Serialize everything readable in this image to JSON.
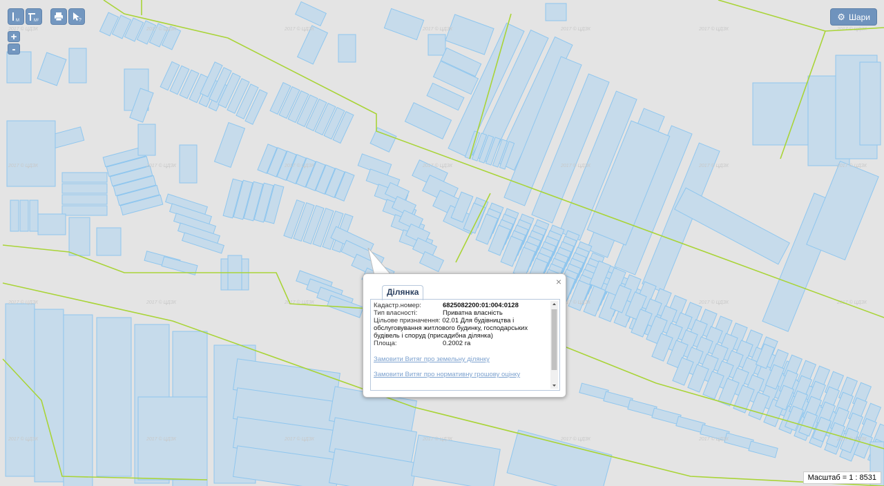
{
  "toolbar": {
    "buttons": [
      {
        "name": "ruler-m-button",
        "icon": "ruler-icon",
        "sub": "M"
      },
      {
        "name": "area-m2-button",
        "icon": "area-ruler-icon",
        "sub": "M²"
      },
      {
        "name": "print-button",
        "icon": "print-icon",
        "sub": ""
      },
      {
        "name": "info-pointer-button",
        "icon": "pointer-question-icon",
        "sub": "?"
      }
    ],
    "zoom_in": "+",
    "zoom_out": "-"
  },
  "layers_button": {
    "label": "Шари",
    "icon": "gear-icon"
  },
  "watermark": "2017 © ЦДЗК",
  "scale": {
    "text": "Масштаб = 1 : 8531"
  },
  "popup": {
    "tab": "Ділянка",
    "close": "×",
    "fields": [
      {
        "label": "Кадастр.номер:",
        "value": "6825082200:01:004:0128"
      },
      {
        "label": "Тип власності:",
        "value": "Приватна власність"
      },
      {
        "label": "Цільове призначення:",
        "value": "02.01 Для будівництва і обслуговування житлового будинку, господарських будівель і споруд (присадибна ділянка)"
      },
      {
        "label": "Площа:",
        "value": "0.2002 га"
      }
    ],
    "links": [
      "Замовити Витяг про земельну ділянку",
      "Замовити Витяг про нормативну грошову оцінку"
    ]
  },
  "colors": {
    "map_bg": "#e4e4e4",
    "parcel_fill": "#c6dbeb",
    "parcel_stroke": "#8fc6ee",
    "boundary": "#a9d437",
    "button": "#7397c0"
  }
}
